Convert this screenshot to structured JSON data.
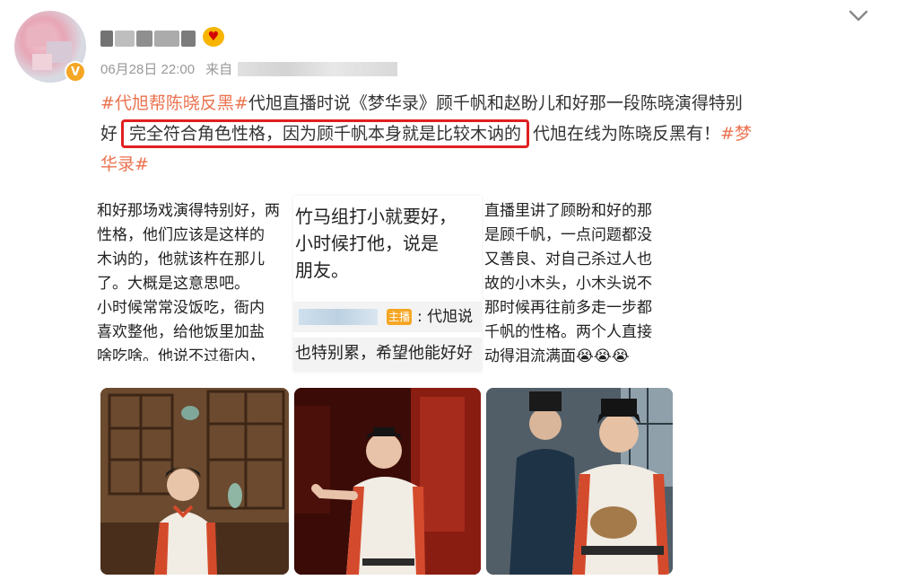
{
  "post": {
    "time": "06月28日 22:00",
    "source_prefix": "来自",
    "line1_tag": "#代旭帮陈晓反黑#",
    "line1_text": "代旭直播时说《梦华录》顾千帆和赵盼儿和好那一段陈晓演得特别",
    "line2_start": "好",
    "line2_highlight": "完全符合角色性格，因为顾千帆本身就是比较木讷的",
    "line2_after": "代旭在线为陈晓反黑有！",
    "line2_tag_start": "#梦",
    "line3_tag_end": "华录#"
  },
  "screenshots": {
    "s1": [
      "和好那场戏演得特别好，两",
      "性格，他们应该是这样的",
      "木讷的，他就该杵在那儿",
      "了。大概是这意思吧。",
      "小时候常常没饭吃，衙内",
      "喜欢整他，给他饭里加盐",
      "啥吃啥。他说不过衙内，"
    ],
    "s2_top": [
      "竹马组打小就要好，",
      "小时候打他，说是",
      "朋友。"
    ],
    "s2_badge": "主播",
    "s2_quote": ": 代旭说",
    "s2_bottom": "也特别累，希望他能好好",
    "s3": [
      "直播里讲了顾盼和好的那",
      "是顾千帆，一点问题都没",
      "又善良、对自己杀过人也",
      "故的小木头，小木头说不",
      "那时候再往前多走一步都",
      "千帆的性格。两个人直接",
      "动得泪流满面😭😭😭"
    ]
  },
  "icons": {
    "avatar_badge": "V",
    "member": "♥"
  },
  "colors": {
    "tag": "#eb7350",
    "highlight_border": "#e02020"
  }
}
